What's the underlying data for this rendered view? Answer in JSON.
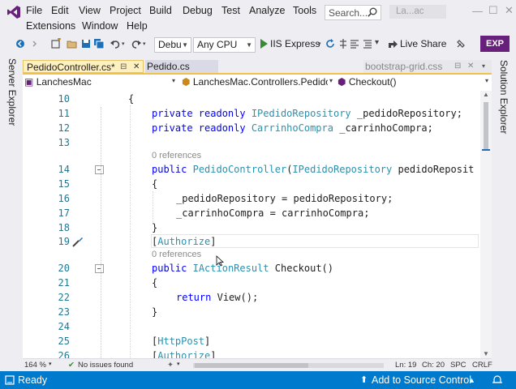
{
  "menu": {
    "row1": [
      "File",
      "Edit",
      "View",
      "Project",
      "Build",
      "Debug",
      "Test",
      "Analyze",
      "Tools"
    ],
    "row2": [
      "Extensions",
      "Window",
      "Help"
    ],
    "search_label": "Search...",
    "solution_name": "La...ac"
  },
  "toolbar": {
    "config": "Debu",
    "platform": "Any CPU",
    "run_target": "IIS Express",
    "live_share": "Live Share",
    "exp_badge": "EXP"
  },
  "side_panels": {
    "left": "Server Explorer",
    "right": "Solution Explorer"
  },
  "tabs": [
    {
      "label": "PedidoController.cs*",
      "pin": "⊟",
      "close": "✕"
    },
    {
      "label": "Pedido.cs"
    },
    {
      "label": "bootstrap-grid.css",
      "pin": "⊟",
      "close": "✕"
    }
  ],
  "navbar": {
    "project": "LanchesMac",
    "class": "LanchesMac.Controllers.PedidoC",
    "member": "Checkout()"
  },
  "editor": {
    "line_numbers": [
      "10",
      "11",
      "12",
      "13",
      "14",
      "15",
      "16",
      "17",
      "18",
      "19",
      "20",
      "21",
      "22",
      "23",
      "24",
      "25",
      "26"
    ],
    "code": {
      "l10": "{",
      "l11_kw": "private readonly",
      "l11_type": "IPedidoRepository",
      "l11_rest": "_pedidoRepository;",
      "l12_kw": "private readonly",
      "l12_type": "CarrinhoCompra",
      "l12_rest": "_carrinhoCompra;",
      "lens_ctor": "0 references",
      "l14_kw": "public",
      "l14_type": "PedidoController",
      "l14_paren": "(",
      "l14_ptype": "IPedidoRepository",
      "l14_rest": "pedidoReposit",
      "l15": "{",
      "l16": "_pedidoRepository = pedidoRepository;",
      "l17": "_carrinhoCompra = carrinhoCompra;",
      "l18": "}",
      "l19_open": "[",
      "l19_attr": "Authorize",
      "l19_close": "]",
      "lens_checkout": "0 references",
      "l20_kw": "public",
      "l20_type": "IActionResult",
      "l20_rest": "Checkout()",
      "l21": "{",
      "l22_kw": "return",
      "l22_rest": "View();",
      "l23": "}",
      "l25_open": "[",
      "l25_attr": "HttpPost",
      "l25_close": "]",
      "l26_open": "[",
      "l26_attr": "Authorize",
      "l26_close": "]"
    }
  },
  "editor_status": {
    "zoom": "164 %",
    "issues": "No issues found",
    "line": "Ln: 19",
    "col": "Ch: 20",
    "spc": "SPC",
    "eol": "CRLF"
  },
  "statusbar": {
    "ready": "Ready",
    "source_control": "Add to Source Control"
  },
  "colors": {
    "accent": "#007acc",
    "keyword": "#0000ff",
    "type": "#2b91af",
    "exp_badge": "#68217a",
    "tab_active": "#fff0c0"
  }
}
